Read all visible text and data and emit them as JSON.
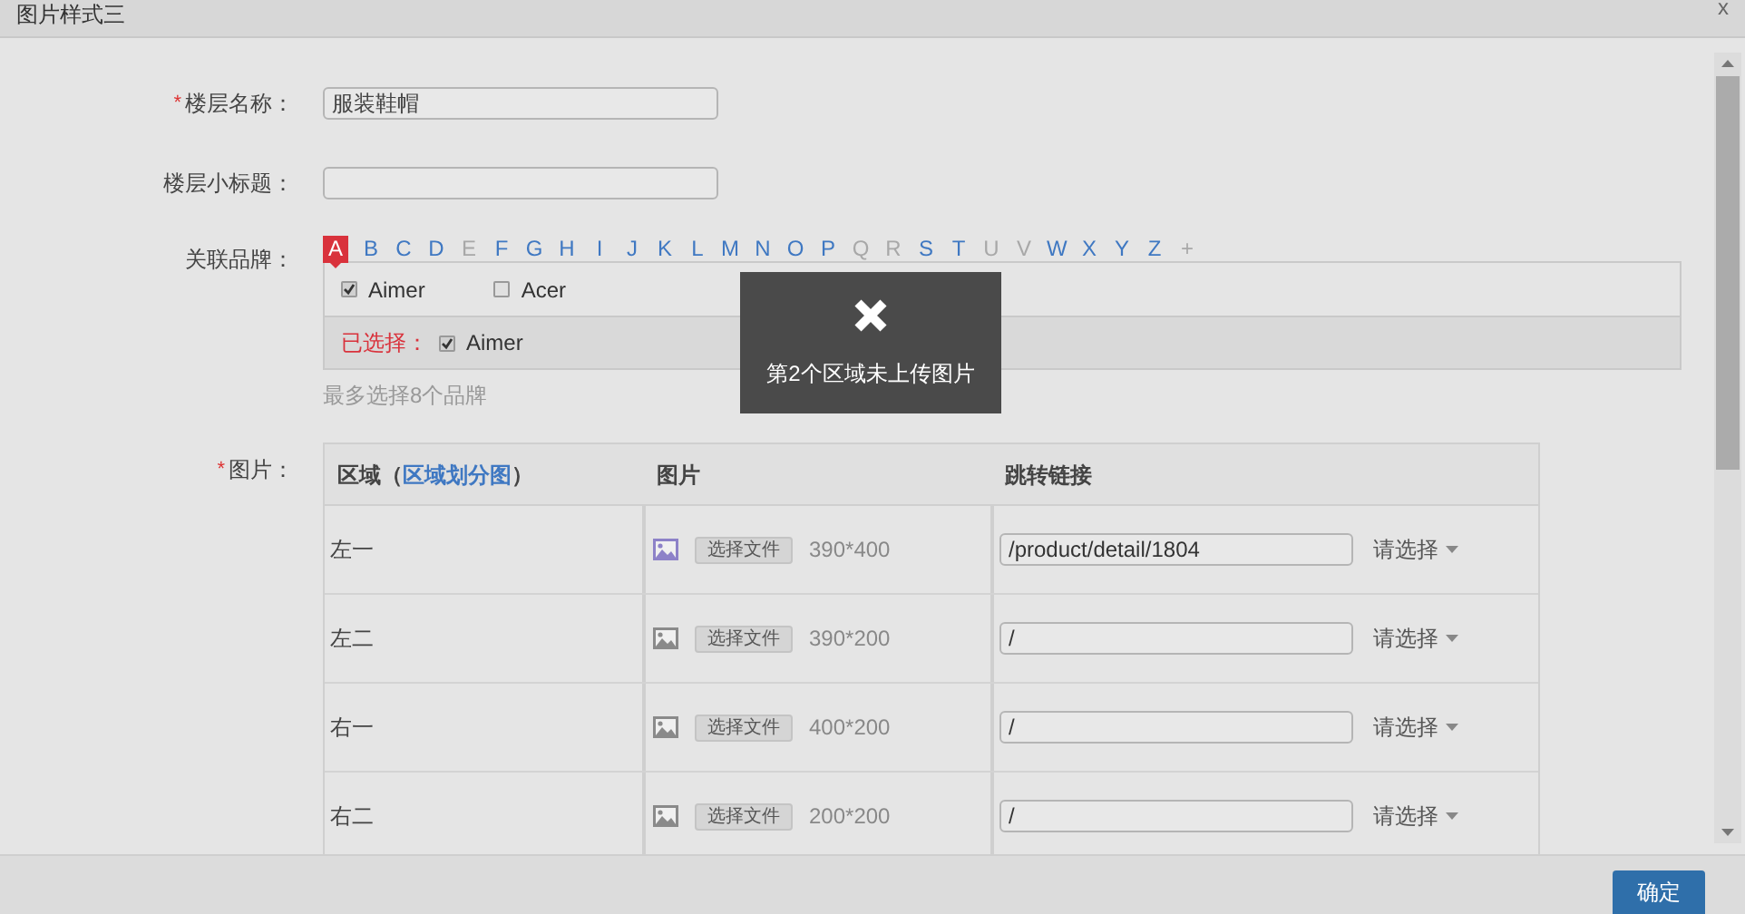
{
  "window": {
    "title": "图片样式三",
    "close": "x"
  },
  "floor_name": {
    "label": "楼层名称：",
    "required_mark": "*",
    "value": "服装鞋帽"
  },
  "floor_subtitle": {
    "label": "楼层小标题："
  },
  "brands": {
    "label": "关联品牌：",
    "letters": [
      {
        "text": "A",
        "selected": true,
        "disabled": false
      },
      {
        "text": "B",
        "selected": false,
        "disabled": false
      },
      {
        "text": "C",
        "selected": false,
        "disabled": false
      },
      {
        "text": "D",
        "selected": false,
        "disabled": false
      },
      {
        "text": "E",
        "selected": false,
        "disabled": true
      },
      {
        "text": "F",
        "selected": false,
        "disabled": false
      },
      {
        "text": "G",
        "selected": false,
        "disabled": false
      },
      {
        "text": "H",
        "selected": false,
        "disabled": false
      },
      {
        "text": "I",
        "selected": false,
        "disabled": false
      },
      {
        "text": "J",
        "selected": false,
        "disabled": false
      },
      {
        "text": "K",
        "selected": false,
        "disabled": false
      },
      {
        "text": "L",
        "selected": false,
        "disabled": false
      },
      {
        "text": "M",
        "selected": false,
        "disabled": false
      },
      {
        "text": "N",
        "selected": false,
        "disabled": false
      },
      {
        "text": "O",
        "selected": false,
        "disabled": false
      },
      {
        "text": "P",
        "selected": false,
        "disabled": false
      },
      {
        "text": "Q",
        "selected": false,
        "disabled": true
      },
      {
        "text": "R",
        "selected": false,
        "disabled": true
      },
      {
        "text": "S",
        "selected": false,
        "disabled": false
      },
      {
        "text": "T",
        "selected": false,
        "disabled": false
      },
      {
        "text": "U",
        "selected": false,
        "disabled": true
      },
      {
        "text": "V",
        "selected": false,
        "disabled": true
      },
      {
        "text": "W",
        "selected": false,
        "disabled": false
      },
      {
        "text": "X",
        "selected": false,
        "disabled": false
      },
      {
        "text": "Y",
        "selected": false,
        "disabled": false
      },
      {
        "text": "Z",
        "selected": false,
        "disabled": false
      },
      {
        "text": "+",
        "selected": false,
        "disabled": true
      }
    ],
    "options": [
      {
        "name": "Aimer",
        "checked": true
      },
      {
        "name": "Acer",
        "checked": false
      }
    ],
    "selected_label": "已选择：",
    "selected": [
      {
        "name": "Aimer",
        "checked": true
      }
    ],
    "hint": "最多选择8个品牌"
  },
  "images": {
    "label": "图片：",
    "required_mark": "*",
    "column_area": {
      "text": "区域（",
      "link": "区域划分图",
      "suffix": "）"
    },
    "column_image": "图片",
    "column_link": "跳转链接",
    "rows": [
      {
        "area": "左一",
        "uploaded": true,
        "file_button": "选择文件",
        "size": "390*400",
        "link": "/product/detail/1804",
        "select": "请选择"
      },
      {
        "area": "左二",
        "uploaded": false,
        "file_button": "选择文件",
        "size": "390*200",
        "link": "/",
        "select": "请选择"
      },
      {
        "area": "右一",
        "uploaded": false,
        "file_button": "选择文件",
        "size": "400*200",
        "link": "/",
        "select": "请选择"
      },
      {
        "area": "右二",
        "uploaded": false,
        "file_button": "选择文件",
        "size": "200*200",
        "link": "/",
        "select": "请选择"
      }
    ]
  },
  "toast": {
    "message": "第2个区域未上传图片"
  },
  "footer": {
    "confirm": "确定"
  }
}
